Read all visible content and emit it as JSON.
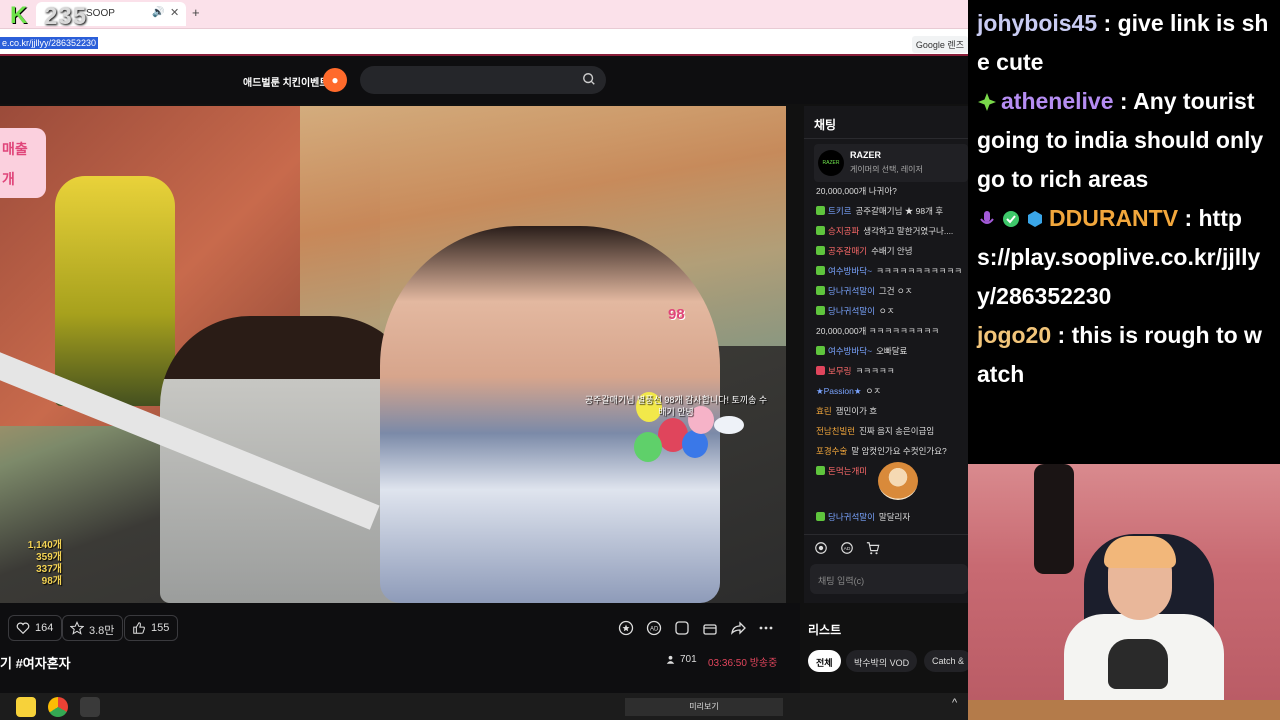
{
  "overlay_badge": {
    "logo": "K",
    "number": "235"
  },
  "browser": {
    "tab_label": "SOOP",
    "new_tab": "+",
    "url": "e.co.kr/jjllyy/286352230",
    "google_chip": "Google 렌즈"
  },
  "header": {
    "event_label": "애드벌룬 치킨이벤트",
    "search_placeholder": ""
  },
  "video": {
    "left_badge_lines": [
      "매출",
      "개"
    ],
    "balloon_count": "98",
    "overlay_message": "공주갈매기님 별풍선 98개 감사합니다! 토끼송 수배기 안녕",
    "gift_counts": [
      "1,140개",
      "359개",
      "337개",
      "98개"
    ]
  },
  "under_video": {
    "pills": [
      {
        "label": "164",
        "icon": "balloon-heart-icon"
      },
      {
        "label": "3.8만",
        "icon": "star-icon"
      },
      {
        "label": "155",
        "icon": "thumbs-up-icon"
      }
    ],
    "title": "기 #여자혼자",
    "viewers": "701",
    "uptime": "03:36:50 방송중"
  },
  "chat": {
    "title": "채팅",
    "sponsor": {
      "name": "RAZER",
      "sub": "게이머의 선택, 레이저",
      "logo": "RAZER"
    },
    "messages": [
      {
        "user": "",
        "text": "20,000,000개 나귀아?"
      },
      {
        "user": "트키르",
        "text": "공주갈매기님 ★ 98개 후"
      },
      {
        "user": "승지공파",
        "text": "생각하고 말한거였구나...."
      },
      {
        "user": "공주갈매기",
        "text": "수배기 안녕"
      },
      {
        "user": "여수방바닥~",
        "text": "ㅋㅋㅋㅋㅋㅋㅋㅋㅋㅋㅋ"
      },
      {
        "user": "당나귀석말이",
        "text": "그건 ㅇㅈ"
      },
      {
        "user": "당나귀석말이",
        "text": "ㅇㅈ"
      },
      {
        "user": "",
        "text": "20,000,000개 ㅋㅋㅋㅋㅋㅋㅋㅋㅋ"
      },
      {
        "user": "여수방바닥~",
        "text": "오빠달료"
      },
      {
        "user": "보무링",
        "text": "ㅋㅋㅋㅋㅋ"
      },
      {
        "user": "★Passion★",
        "text": "ㅇㅈ"
      },
      {
        "user": "효린",
        "text": "잼민이가 흐"
      },
      {
        "user": "전남친빌런",
        "text": "진짜 음지 송은이급임"
      },
      {
        "user": "포경수술",
        "text": "말 암컷인가요 수컷인가요?"
      },
      {
        "user": "돈먹는개미",
        "text": ""
      },
      {
        "user": "당나귀석말이",
        "text": "말달리자"
      }
    ],
    "input_placeholder": "채팅 입력(c)"
  },
  "list": {
    "title": "리스트",
    "chips": [
      "전체",
      "박수박의 VOD",
      "Catch &"
    ]
  },
  "taskbar": {
    "preview": "미리보기",
    "tray_arrow": "^"
  },
  "overlay_chat": [
    {
      "name": "johybois45",
      "text": " : give link is she cute"
    },
    {
      "name": "athenelive",
      "text": " : Any tourist going to india should only go to rich areas"
    },
    {
      "name": "DDURANTV",
      "text": " : https://play.sooplive.co.kr/jjllyy/286352230"
    },
    {
      "name": "jogo20",
      "text": " : this is rough to watch"
    }
  ],
  "colors": {
    "accent": "#e0455c",
    "chat_user": "#7aa4ff",
    "badge_green": "#5fc53d"
  }
}
